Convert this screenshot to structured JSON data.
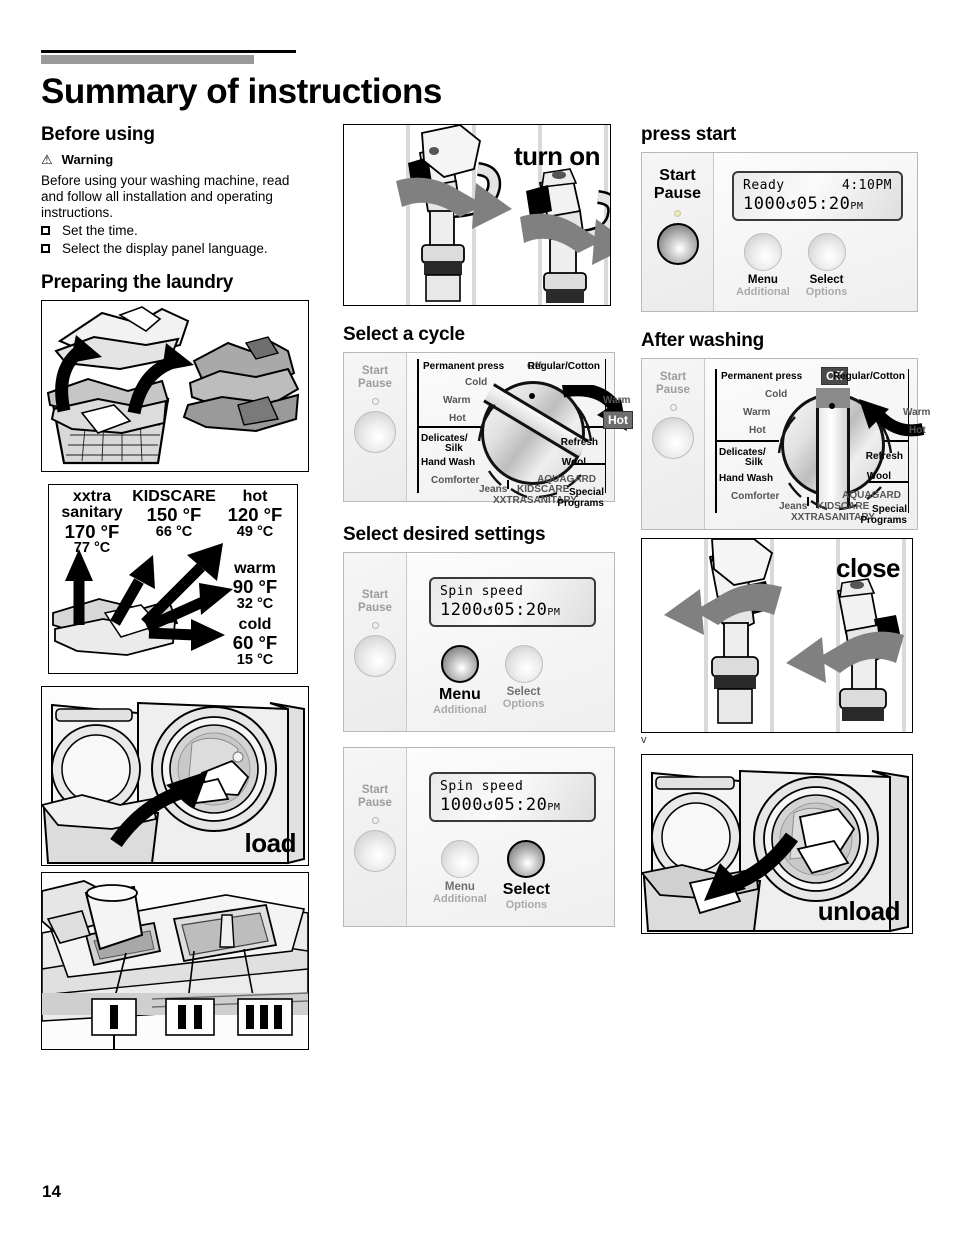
{
  "page": {
    "title": "Summary of instructions",
    "number": "14",
    "stray_mark": "v"
  },
  "before_using": {
    "heading": "Before using",
    "warning_icon": "warning-triangle-icon",
    "warning_label": "Warning",
    "body": "Before using your washing machine, read and follow all installation and operating instructions.",
    "checklist": [
      "Set the time.",
      "Select the display panel language."
    ]
  },
  "preparing_laundry": {
    "heading": "Preparing the laundry",
    "sort_figure_alt": "sort-laundry-figure"
  },
  "temperature_chart": {
    "columns": [
      {
        "name": "xxtra sanitary",
        "f": "170 °F",
        "c": "77 °C"
      },
      {
        "name": "KIDSCARE",
        "f": "150 °F",
        "c": "66 °C"
      },
      {
        "name": "hot",
        "f": "120 °F",
        "c": "49 °C"
      },
      {
        "name": "warm",
        "f": "90 °F",
        "c": "32 °C"
      },
      {
        "name": "cold",
        "f": "60 °F",
        "c": "15 °C"
      }
    ]
  },
  "load_figure": {
    "label": "load"
  },
  "dispenser_figure": {
    "compartments": [
      "I",
      "II",
      "III"
    ]
  },
  "turn_on_figure": {
    "label": "turn on"
  },
  "close_figure": {
    "label": "close"
  },
  "unload_figure": {
    "label": "unload"
  },
  "select_cycle": {
    "heading": "Select a cycle",
    "start_pause": {
      "line1": "Start",
      "line2": "Pause"
    },
    "dial": {
      "off": "Off",
      "left_group": "Permanent press",
      "right_group": "Regular/Cotton",
      "left_temps": [
        "Cold",
        "Warm",
        "Hot"
      ],
      "right_temps": [
        "Warm",
        "Hot"
      ],
      "selected_temp": "Hot",
      "left_cycles": [
        "Delicates/",
        "Silk",
        "Hand Wash",
        "Comforter"
      ],
      "right_cycles": [
        "Refresh",
        "Wool"
      ],
      "aquagard_a": "AQUA",
      "aquagard_b": "GARD",
      "kidscare_a": "KIDS",
      "kidscare_b": "CARE",
      "xxtra_a": "XXTRA",
      "xxtra_b": "SANITARY",
      "jeans": "Jeans",
      "special_1": "Special",
      "special_2": "Programs"
    }
  },
  "select_settings": {
    "heading": "Select desired settings",
    "panels": [
      {
        "start_pause": {
          "line1": "Start",
          "line2": "Pause"
        },
        "lcd": {
          "line1": "Spin speed",
          "value": "1200",
          "clock_icon": "↺",
          "time": "05:20",
          "meridiem": "PM"
        },
        "buttons": [
          {
            "label": "Menu",
            "sub": "Additional",
            "active": true
          },
          {
            "label": "Select",
            "sub": "Options",
            "active": false
          }
        ]
      },
      {
        "start_pause": {
          "line1": "Start",
          "line2": "Pause"
        },
        "lcd": {
          "line1": "Spin speed",
          "value": "1000",
          "clock_icon": "↺",
          "time": "05:20",
          "meridiem": "PM"
        },
        "buttons": [
          {
            "label": "Menu",
            "sub": "Additional",
            "active": false
          },
          {
            "label": "Select",
            "sub": "Options",
            "active": true
          }
        ]
      }
    ]
  },
  "press_start": {
    "heading": "press start",
    "start_pause": {
      "line1": "Start",
      "line2": "Pause"
    },
    "lcd": {
      "status": "Ready",
      "clock": "4:10PM",
      "value": "1000",
      "clock_icon": "↺",
      "time": "05:20",
      "meridiem": "PM"
    },
    "buttons": [
      {
        "label": "Menu",
        "sub": "Additional"
      },
      {
        "label": "Select",
        "sub": "Options"
      }
    ]
  },
  "after_washing": {
    "heading": "After washing",
    "start_pause": {
      "line1": "Start",
      "line2": "Pause"
    },
    "dial": {
      "off": "Off",
      "left_group": "Permanent press",
      "right_group": "Regular/Cotton",
      "left_temps": [
        "Cold",
        "Warm",
        "Hot"
      ],
      "right_temps": [
        "Warm",
        "Hot"
      ],
      "left_cycles": [
        "Delicates/",
        "Silk",
        "Hand Wash",
        "Comforter"
      ],
      "right_cycles": [
        "Refresh",
        "Wool"
      ],
      "aquagard_a": "AQUA",
      "aquagard_b": "GARD",
      "kidscare_a": "KIDS",
      "kidscare_b": "CARE",
      "xxtra_a": "XXTRA",
      "xxtra_b": "SANITARY",
      "jeans": "Jeans",
      "special_1": "Special",
      "special_2": "Programs"
    }
  }
}
